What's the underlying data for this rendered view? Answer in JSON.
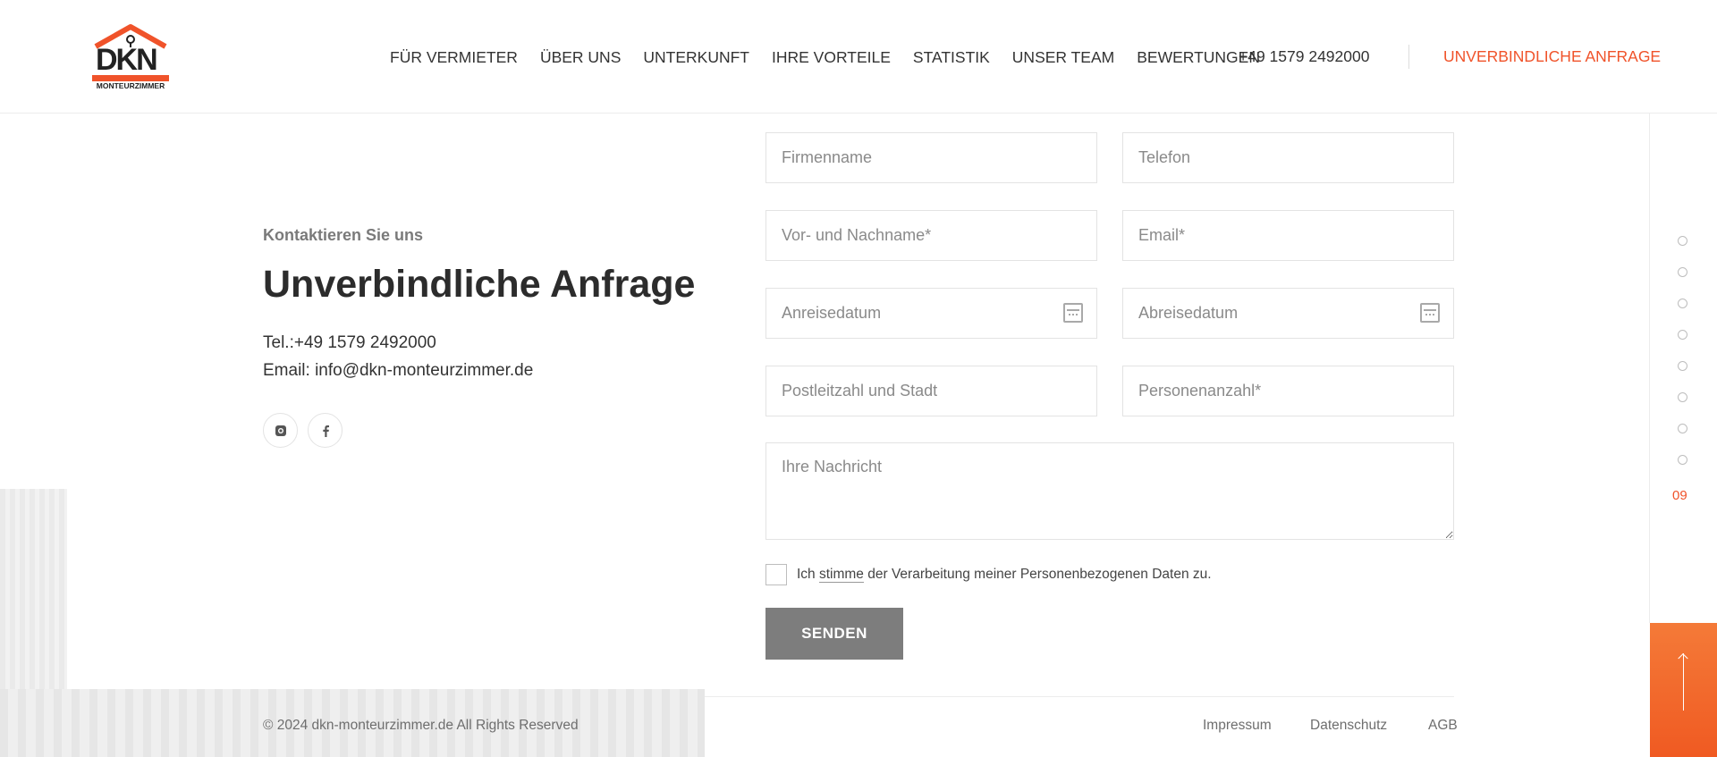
{
  "header": {
    "logo_text": "DKN",
    "logo_sub": "MONTEURZIMMER",
    "nav": [
      "FÜR VERMIETER",
      "ÜBER UNS",
      "UNTERKUNFT",
      "IHRE VORTEILE",
      "STATISTIK",
      "UNSER TEAM",
      "BEWERTUNGEN"
    ],
    "phone": "+49 1579 2492000",
    "cta": "UNVERBINDLICHE ANFRAGE"
  },
  "contact": {
    "subtitle": "Kontaktieren Sie uns",
    "title": "Unverbindliche Anfrage",
    "phone_line": "Tel.:+49 1579 2492000",
    "email_line": "Email: info@dkn-monteurzimmer.de"
  },
  "form": {
    "firma": "Firmenname",
    "telefon": "Telefon",
    "name": "Vor- und Nachname*",
    "email": "Email*",
    "anreise": "Anreisedatum",
    "abreise": "Abreisedatum",
    "plz": "Postleitzahl und Stadt",
    "personen": "Personenanzahl*",
    "nachricht": "Ihre Nachricht",
    "consent_pre": "Ich ",
    "consent_link": "stimme",
    "consent_post": " der Verarbeitung meiner Personenbezogenen Daten zu.",
    "submit": "SENDEN"
  },
  "side_nav": {
    "current": "09"
  },
  "footer": {
    "copyright": "© 2024 dkn-monteurzimmer.de All Rights Reserved",
    "impressum": "Impressum",
    "datenschutz": "Datenschutz",
    "agb": "AGB"
  },
  "colors": {
    "accent": "#f0532a",
    "button": "#7d7d7d"
  },
  "icons": {
    "social": [
      "instagram-icon",
      "facebook-icon"
    ],
    "date": "calendar-icon",
    "scroll": "arrow-up-icon"
  }
}
